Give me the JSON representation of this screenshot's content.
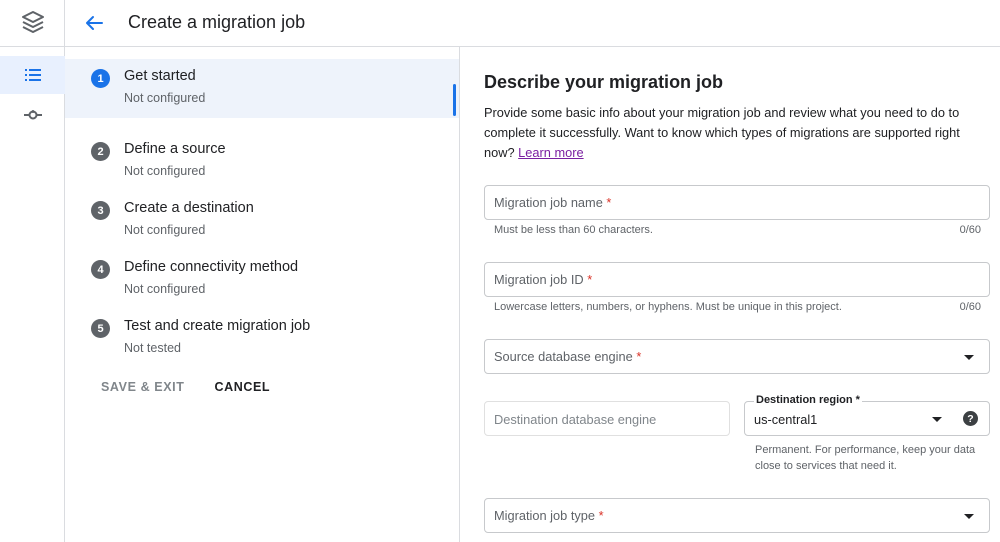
{
  "header": {
    "title": "Create a migration job"
  },
  "rail": {
    "items": [
      "list-icon",
      "connection-icon"
    ]
  },
  "steps": [
    {
      "number": "1",
      "label": "Get started",
      "status": "Not configured",
      "active": true
    },
    {
      "number": "2",
      "label": "Define a source",
      "status": "Not configured",
      "active": false
    },
    {
      "number": "3",
      "label": "Create a destination",
      "status": "Not configured",
      "active": false
    },
    {
      "number": "4",
      "label": "Define connectivity method",
      "status": "Not configured",
      "active": false
    },
    {
      "number": "5",
      "label": "Test and create migration job",
      "status": "Not tested",
      "active": false
    }
  ],
  "actions": {
    "save_exit": "SAVE & EXIT",
    "cancel": "CANCEL"
  },
  "main": {
    "title": "Describe your migration job",
    "description": "Provide some basic info about your migration job and review what you need to do to complete it successfully. Want to know which types of migrations are supported right now?",
    "learn_more": "Learn more",
    "required_mark": "*",
    "fields": {
      "job_name": {
        "label": "Migration job name",
        "hint": "Must be less than 60 characters.",
        "counter": "0/60"
      },
      "job_id": {
        "label": "Migration job ID",
        "hint": "Lowercase letters, numbers, or hyphens. Must be unique in this project.",
        "counter": "0/60"
      },
      "source_engine": {
        "label": "Source database engine"
      },
      "dest_engine": {
        "label": "Destination database engine"
      },
      "dest_region": {
        "label": "Destination region",
        "value": "us-central1",
        "hint": "Permanent. For performance, keep your data close to services that need it.",
        "help": "?"
      },
      "job_type": {
        "label": "Migration job type"
      }
    }
  },
  "colors": {
    "accent": "#1a73e8",
    "required": "#d93025",
    "link": "#7b1fa2"
  }
}
